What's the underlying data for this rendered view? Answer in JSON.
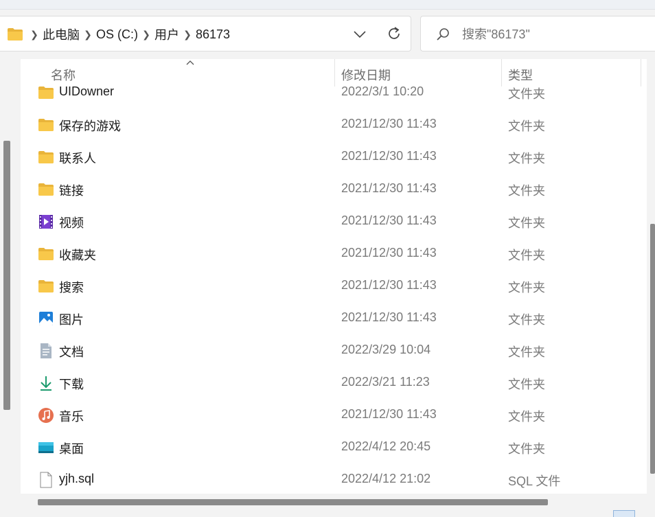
{
  "address_bar": {
    "crumbs": [
      "此电脑",
      "OS (C:)",
      "用户",
      "86173"
    ]
  },
  "search": {
    "placeholder": "搜索\"86173\""
  },
  "columns": {
    "name": "名称",
    "date": "修改日期",
    "type": "类型"
  },
  "files": [
    {
      "name": "UIDowner",
      "date": "2022/3/1 10:20",
      "type": "文件夹",
      "icon": "folder-icon"
    },
    {
      "name": "保存的游戏",
      "date": "2021/12/30 11:43",
      "type": "文件夹",
      "icon": "folder-icon"
    },
    {
      "name": "联系人",
      "date": "2021/12/30 11:43",
      "type": "文件夹",
      "icon": "folder-icon"
    },
    {
      "name": "链接",
      "date": "2021/12/30 11:43",
      "type": "文件夹",
      "icon": "folder-icon"
    },
    {
      "name": "视频",
      "date": "2021/12/30 11:43",
      "type": "文件夹",
      "icon": "videos-folder-icon"
    },
    {
      "name": "收藏夹",
      "date": "2021/12/30 11:43",
      "type": "文件夹",
      "icon": "folder-icon"
    },
    {
      "name": "搜索",
      "date": "2021/12/30 11:43",
      "type": "文件夹",
      "icon": "folder-icon"
    },
    {
      "name": "图片",
      "date": "2021/12/30 11:43",
      "type": "文件夹",
      "icon": "pictures-folder-icon"
    },
    {
      "name": "文档",
      "date": "2022/3/29 10:04",
      "type": "文件夹",
      "icon": "documents-folder-icon"
    },
    {
      "name": "下载",
      "date": "2022/3/21 11:23",
      "type": "文件夹",
      "icon": "downloads-folder-icon"
    },
    {
      "name": "音乐",
      "date": "2021/12/30 11:43",
      "type": "文件夹",
      "icon": "music-folder-icon"
    },
    {
      "name": "桌面",
      "date": "2022/4/12 20:45",
      "type": "文件夹",
      "icon": "desktop-folder-icon"
    },
    {
      "name": "yjh.sql",
      "date": "2022/4/12 21:02",
      "type": "SQL 文件",
      "icon": "file-icon"
    }
  ],
  "colors": {
    "folder": "#f8c84a",
    "accent": "#0a66c2",
    "scrollbar": "#8a8a8a"
  }
}
